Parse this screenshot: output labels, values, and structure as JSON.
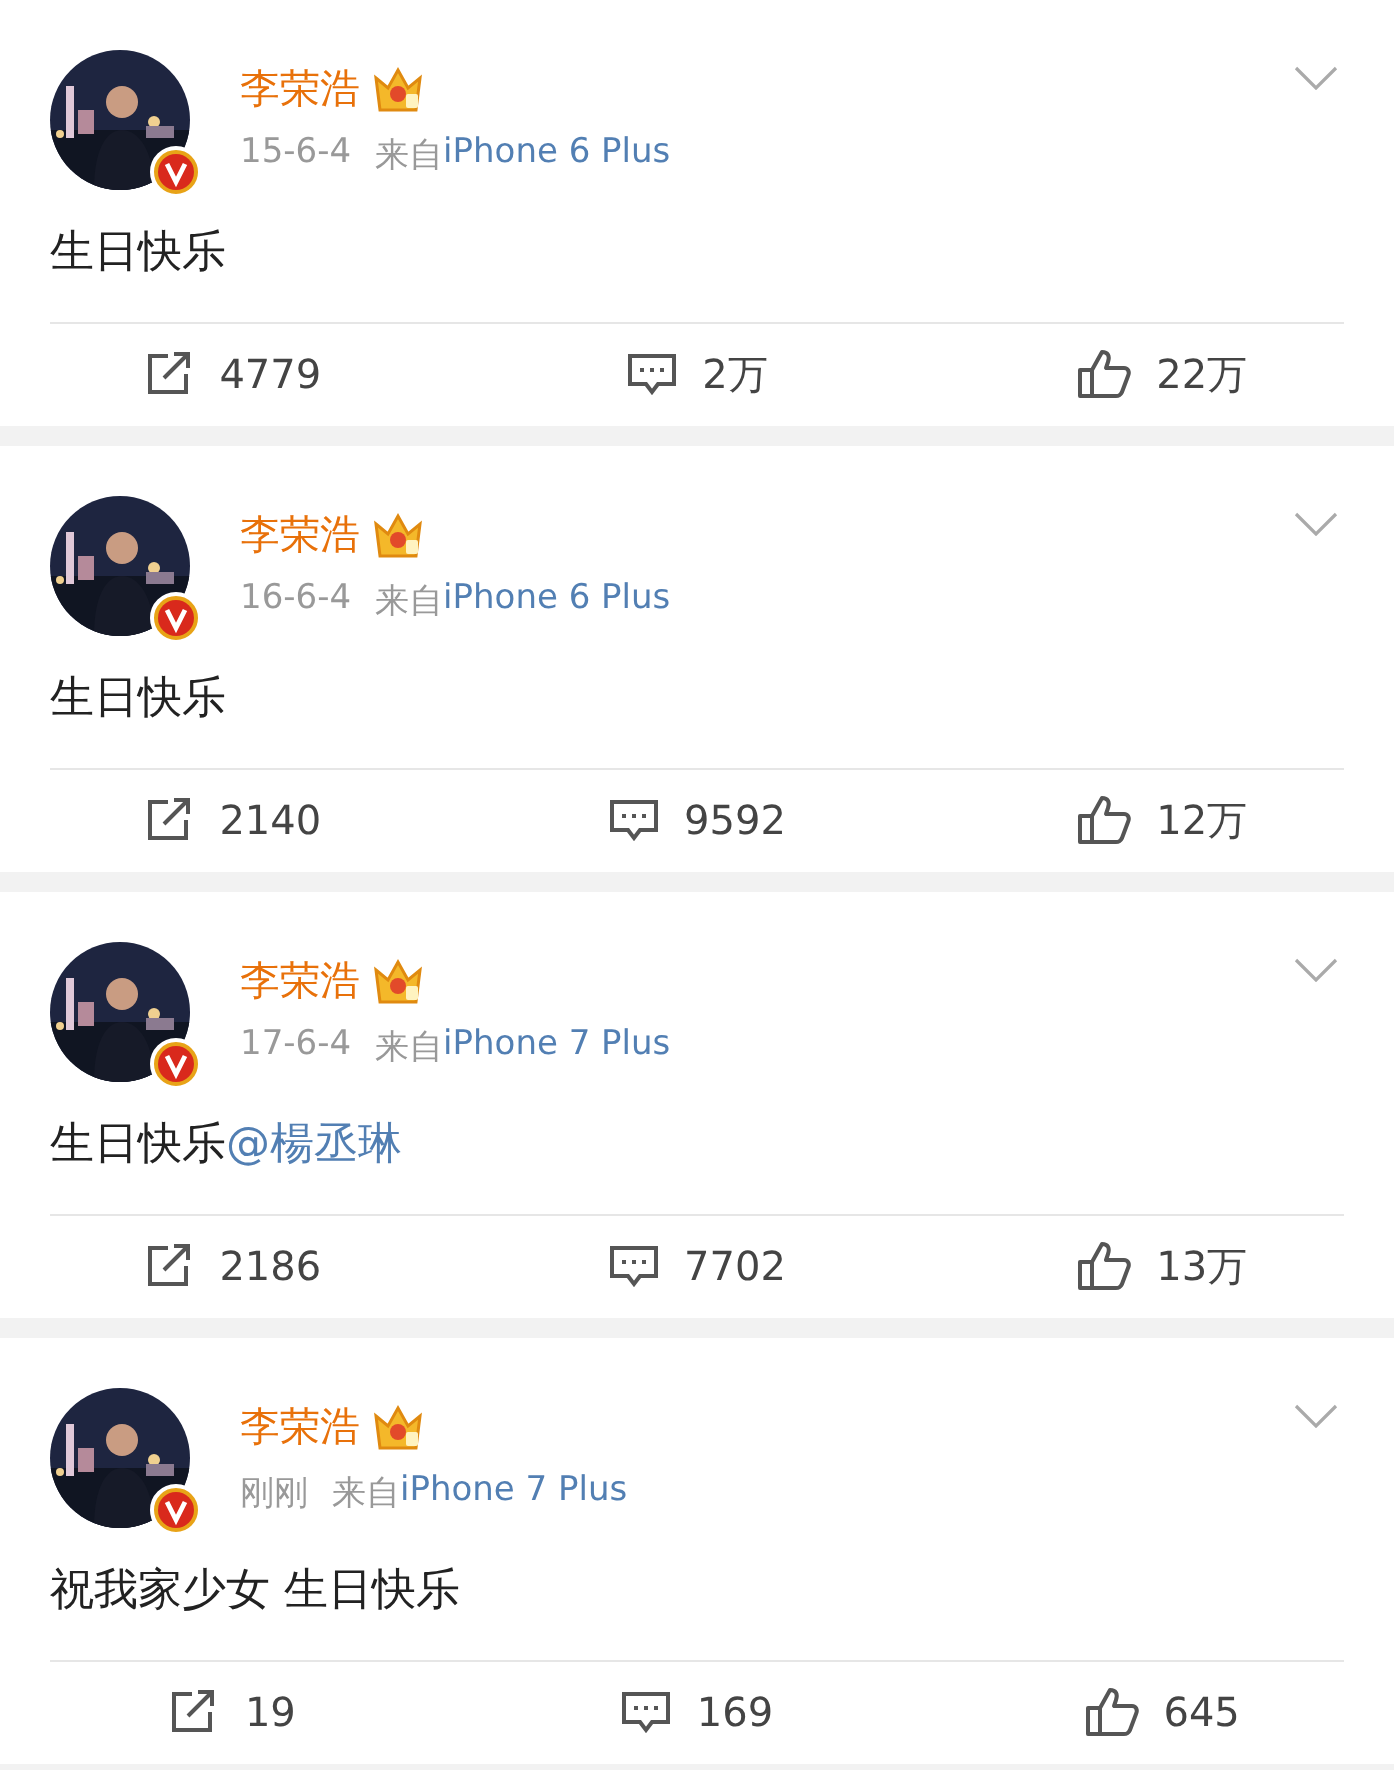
{
  "posts": [
    {
      "author": "李荣浩",
      "time": "15-6-4",
      "source_prefix": "来自",
      "source": "iPhone 6 Plus",
      "body": [
        {
          "kind": "text",
          "text": "生日快乐"
        }
      ],
      "actions": [
        {
          "kind": "repost",
          "count": "4779"
        },
        {
          "kind": "comment",
          "count": "2万"
        },
        {
          "kind": "like",
          "count": "22万"
        }
      ]
    },
    {
      "author": "李荣浩",
      "time": "16-6-4",
      "source_prefix": "来自",
      "source": "iPhone 6 Plus",
      "body": [
        {
          "kind": "text",
          "text": "生日快乐"
        }
      ],
      "actions": [
        {
          "kind": "repost",
          "count": "2140"
        },
        {
          "kind": "comment",
          "count": "9592"
        },
        {
          "kind": "like",
          "count": "12万"
        }
      ]
    },
    {
      "author": "李荣浩",
      "time": "17-6-4",
      "source_prefix": "来自",
      "source": "iPhone 7 Plus",
      "body": [
        {
          "kind": "text",
          "text": "生日快乐"
        },
        {
          "kind": "mention",
          "text": "@楊丞琳"
        }
      ],
      "actions": [
        {
          "kind": "repost",
          "count": "2186"
        },
        {
          "kind": "comment",
          "count": "7702"
        },
        {
          "kind": "like",
          "count": "13万"
        }
      ]
    },
    {
      "author": "李荣浩",
      "time": "刚刚",
      "source_prefix": "来自",
      "source": "iPhone 7 Plus",
      "body": [
        {
          "kind": "text",
          "text": "祝我家少女 生日快乐"
        }
      ],
      "actions": [
        {
          "kind": "repost",
          "count": "19"
        },
        {
          "kind": "comment",
          "count": "169"
        },
        {
          "kind": "like",
          "count": "645"
        }
      ]
    }
  ]
}
